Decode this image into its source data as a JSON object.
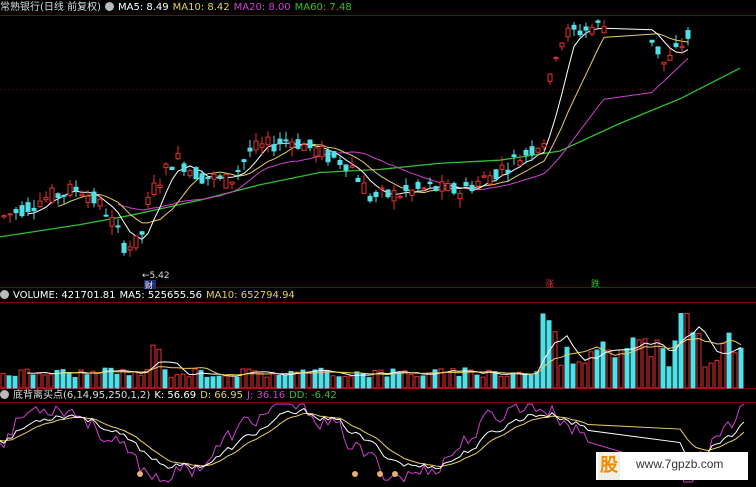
{
  "price_header": {
    "title": "常熟银行(日线 前复权)",
    "ma5": "MA5: 8.49",
    "ma10": "MA10: 8.42",
    "ma20": "MA20: 8.00",
    "ma60": "MA60: 7.48"
  },
  "volume_header": {
    "volume": "VOLUME: 421701.81",
    "ma5": "MA5: 525655.56",
    "ma10": "MA10: 652794.94"
  },
  "indicator_header": {
    "name": "底背离买点(6,14,95,250,1,2)",
    "k": "K: 56.69",
    "d": "D: 66.95",
    "j": "J: 36.16",
    "dd": "DD: -6.42"
  },
  "annotations": {
    "low_label": "←5.42",
    "cai_marker": "财",
    "zhang_marker": "涨",
    "die_marker": "跌"
  },
  "watermark": {
    "logo": "股",
    "site": "www.7gpzb.com"
  },
  "colors": {
    "up": "#e83030",
    "down": "#50e0e8",
    "ma5": "#ffffff",
    "ma10": "#e8d060",
    "ma20": "#d040d0",
    "ma60": "#30c030",
    "grid": "#7a0000"
  },
  "chart_data": {
    "type": "candlestick",
    "price": {
      "ylim": [
        5.2,
        9.6
      ],
      "ma60_points": [
        [
          0,
          6.0
        ],
        [
          80,
          6.2
        ],
        [
          130,
          6.35
        ],
        [
          200,
          6.6
        ],
        [
          260,
          6.85
        ],
        [
          320,
          7.05
        ],
        [
          380,
          7.1
        ],
        [
          440,
          7.2
        ],
        [
          500,
          7.25
        ],
        [
          560,
          7.4
        ],
        [
          620,
          7.85
        ],
        [
          680,
          8.25
        ],
        [
          740,
          8.75
        ]
      ]
    },
    "volume": {
      "ylim": [
        0,
        1000000
      ]
    },
    "indicator": {
      "ylim": [
        -20,
        110
      ]
    }
  }
}
